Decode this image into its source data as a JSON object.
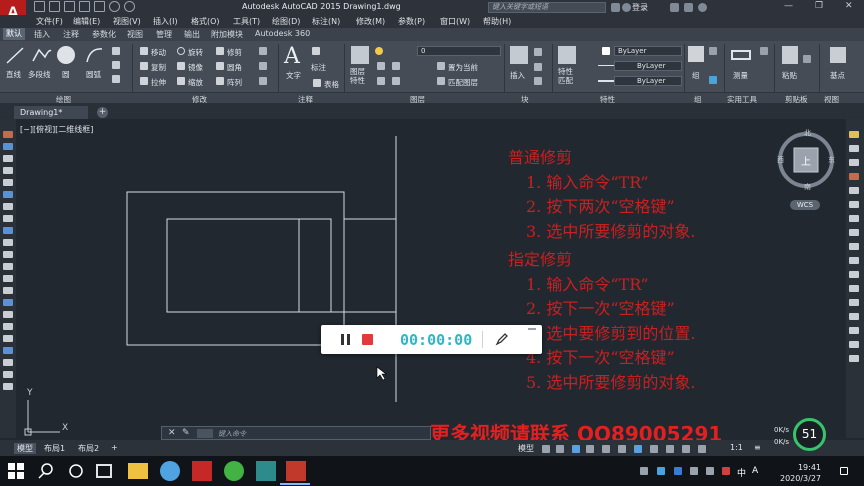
{
  "window": {
    "app_title": "Autodesk AutoCAD 2015    Drawing1.dwg",
    "search_placeholder": "键入关键字或短语",
    "login_label": "登录",
    "logo_letter": "A"
  },
  "menu": [
    "文件(F)",
    "编辑(E)",
    "视图(V)",
    "插入(I)",
    "格式(O)",
    "工具(T)",
    "绘图(D)",
    "标注(N)",
    "修改(M)",
    "参数(P)",
    "窗口(W)",
    "帮助(H)"
  ],
  "ribbon_tabs": [
    "默认",
    "插入",
    "注释",
    "参数化",
    "视图",
    "管理",
    "输出",
    "附加模块",
    "Autodesk 360"
  ],
  "ribbon": {
    "draw_tools": [
      "直线",
      "多段线",
      "圆",
      "圆弧"
    ],
    "modify_tools": [
      "移动",
      "旋转",
      "修剪",
      "复制",
      "镜像",
      "圆角",
      "拉伸",
      "缩放",
      "阵列"
    ],
    "annotation_tools": [
      "文字",
      "标注",
      "表格"
    ],
    "layer_tools": [
      "图层特性",
      "置为当前",
      "匹配图层"
    ],
    "layer_value": "0",
    "block_tool": "插入",
    "match_tool": "特性匹配",
    "bylayer_1": "ByLayer",
    "bylayer_2": "ByLayer",
    "bylayer_3": "ByLayer",
    "group_tool": "组",
    "measure_tool": "测量",
    "paste_tool": "粘贴",
    "base_tool": "基点",
    "panels": [
      "绘图",
      "修改",
      "注释",
      "图层",
      "块",
      "特性",
      "组",
      "实用工具",
      "剪贴板",
      "视图"
    ]
  },
  "doc_tab": "Drawing1*",
  "viewport_label": "[−][俯视][二维线框]",
  "viewcube": {
    "north": "北",
    "south": "南",
    "east": "东",
    "west": "西",
    "face": "上",
    "wcs": "WCS"
  },
  "notes": {
    "title1": "普通修剪",
    "steps1": [
      "1. 输入命令“TR”",
      "2. 按下两次“空格键”",
      "3. 选中所要修剪的对象."
    ],
    "title2": "指定修剪",
    "steps2": [
      "1. 输入命令“TR”",
      "2. 按下一次“空格键”",
      "3. 选中要修剪到的位置.",
      "4. 按下一次“空格键”",
      "5. 选中所要修剪的对象."
    ]
  },
  "recorder": {
    "time": "00:00:00"
  },
  "promo": "更多视频请联系  QQ89005291",
  "command": {
    "placeholder": "键入命令"
  },
  "ucs": {
    "x": "X",
    "y": "Y"
  },
  "layout_tabs": [
    "模型",
    "布局1",
    "布局2"
  ],
  "status": {
    "model": "模型",
    "scale": "1:1"
  },
  "network": {
    "up": "0K/s",
    "down": "0K/s",
    "cpu": "51"
  },
  "clock": {
    "time": "19:41",
    "date": "2020/3/27"
  },
  "tray": {
    "lang": "中",
    "ime": "A"
  },
  "colors": {
    "accent": "#cc1f1f",
    "timer": "#2db7c4",
    "ribbon_bg": "#454c56",
    "canvas_bg": "#212830"
  }
}
